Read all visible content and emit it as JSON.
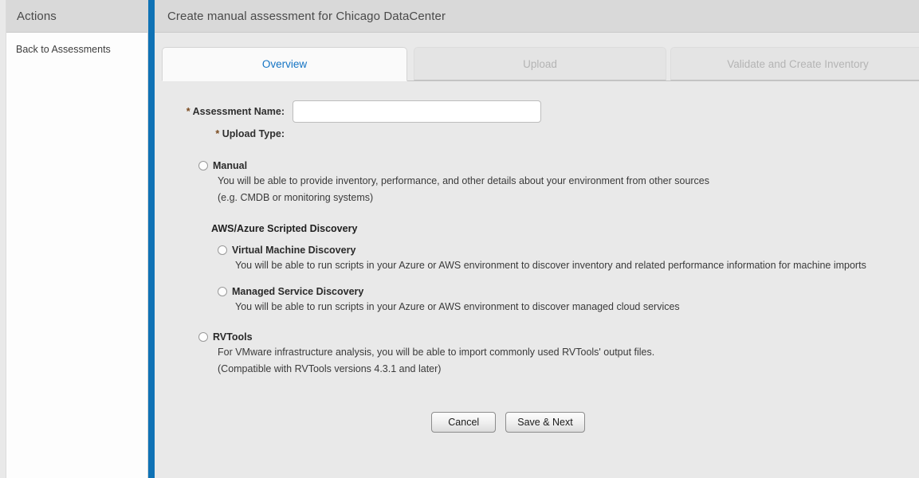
{
  "sidebar": {
    "header_title": "Actions",
    "links": [
      {
        "label": "Back to Assessments"
      }
    ]
  },
  "header": {
    "title": "Create manual assessment for Chicago DataCenter"
  },
  "tabs": [
    {
      "label": "Overview",
      "state": "active"
    },
    {
      "label": "Upload",
      "state": "disabled"
    },
    {
      "label": "Validate and Create Inventory",
      "state": "disabled"
    }
  ],
  "form": {
    "assessment_name": {
      "required_mark": "*",
      "label": "Assessment Name:",
      "value": "",
      "placeholder": ""
    },
    "upload_type": {
      "required_mark": "*",
      "label": "Upload Type:"
    },
    "options": {
      "manual": {
        "label": "Manual",
        "desc_line1": "You will be able to provide inventory, performance, and other details about your environment from other sources",
        "desc_line2": "(e.g. CMDB or monitoring systems)",
        "selected": false
      },
      "scripted_discovery_heading": "AWS/Azure Scripted Discovery",
      "virtual_machine_discovery": {
        "label": "Virtual Machine Discovery",
        "desc_line1": "You will be able to run scripts in your Azure or AWS environment to discover inventory and related performance information for machine imports",
        "selected": false
      },
      "managed_service_discovery": {
        "label": "Managed Service Discovery",
        "desc_line1": "You will be able to run scripts in your Azure or AWS environment to discover managed cloud services",
        "selected": false
      },
      "rvtools": {
        "label": "RVTools",
        "desc_line1": "For VMware infrastructure analysis, you will be able to import commonly used RVTools' output files.",
        "desc_line2": "(Compatible with RVTools versions 4.3.1 and later)",
        "selected": false
      }
    }
  },
  "buttons": {
    "cancel": "Cancel",
    "save_next": "Save & Next"
  },
  "colors": {
    "accent_blue": "#0f72b5",
    "tab_active_text": "#1474c4",
    "header_bg": "#d9d9d9",
    "main_bg": "#e9e9e9",
    "required_star": "#7a4a1f"
  }
}
